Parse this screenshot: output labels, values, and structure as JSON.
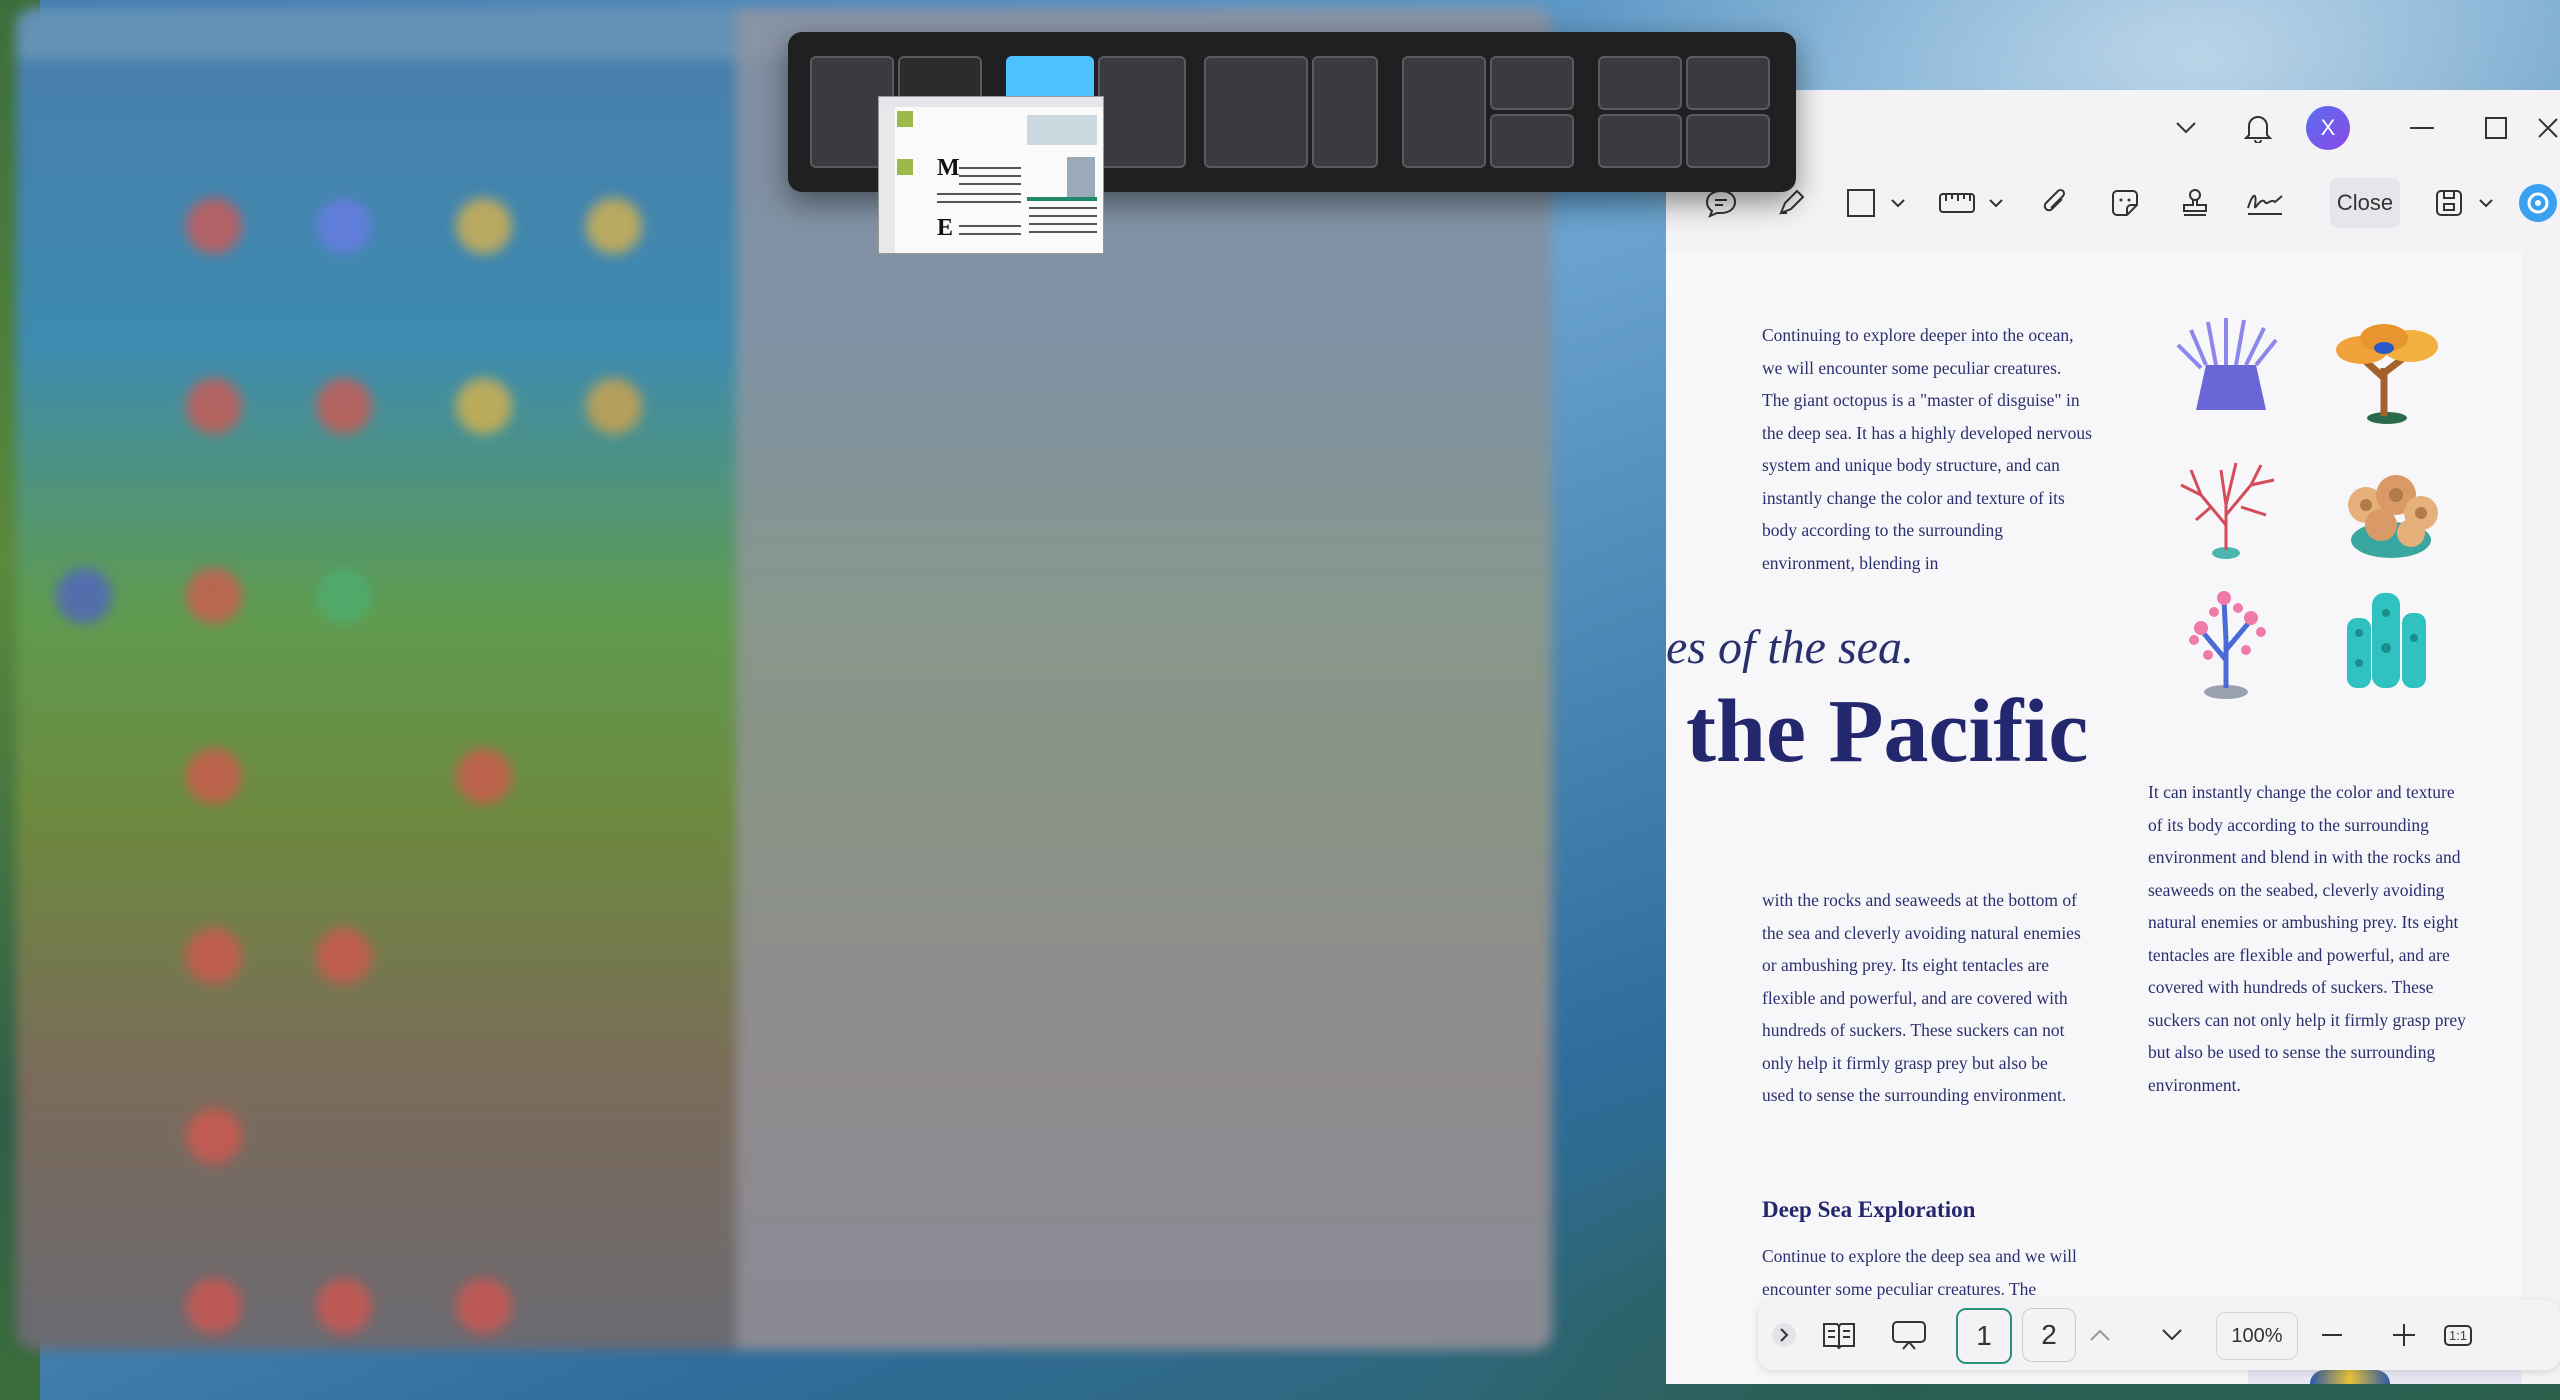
{
  "app": {
    "account_initial": "X",
    "close_label": "Close"
  },
  "document": {
    "para_top_left": "Continuing to explore deeper into the ocean, we will encounter some peculiar creatures. The giant octopus is a \"master of disguise\" in the deep sea. It has a highly developed nervous system and unique body structure, and can instantly change the color and texture of its body according to the surrounding environment, blending in",
    "italic_line": "es of the sea.",
    "big_title": "the Pacific",
    "para_right": "It can instantly change the color and texture of its body according to the surrounding environment and blend in with the rocks and seaweeds on the seabed, cleverly avoiding natural enemies or ambushing prey. Its eight tentacles are flexible and powerful, and are covered with hundreds of suckers. These suckers can not only help it firmly grasp prey but also be used to sense the surrounding environment.",
    "para_bottom_left": "with the rocks and seaweeds at the bottom of the sea and cleverly avoiding natural enemies or ambushing prey. Its eight tentacles are flexible and powerful, and are covered with hundreds of suckers. These suckers can not only help it firmly grasp prey but also be used to sense the surrounding environment.",
    "section_heading": "Deep Sea Exploration",
    "para_section": "Continue to explore the deep sea and we will encounter some peculiar creatures. The"
  },
  "bottombar": {
    "page_current": "1",
    "page_other": "2",
    "zoom": "100%",
    "fit_label": "1:1"
  },
  "snap_layouts": {
    "active_zone": "left-two-thirds"
  },
  "icons": [
    "chevron-down-icon",
    "bell-icon",
    "minimize-icon",
    "maximize-icon",
    "close-icon",
    "comment-icon",
    "highlighter-icon",
    "rectangle-icon",
    "measure-icon",
    "attachment-icon",
    "sticker-icon",
    "stamp-icon",
    "signature-icon",
    "save-icon",
    "ai-assistant-icon",
    "expand-icon",
    "reading-mode-icon",
    "presentation-icon",
    "page-up-icon",
    "page-down-icon",
    "zoom-out-icon",
    "zoom-in-icon"
  ],
  "colors": {
    "text_navy": "#23276e",
    "snap_active": "#4cc2ff",
    "accent_teal": "#2d8f7f"
  }
}
